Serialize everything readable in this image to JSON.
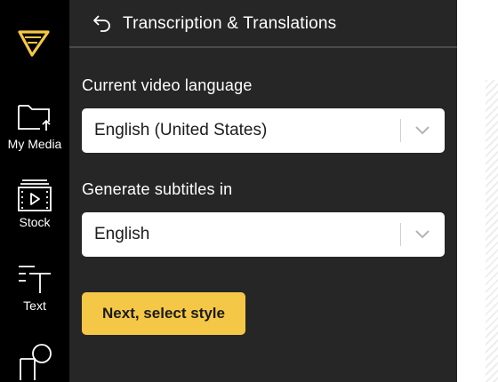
{
  "sidebar": {
    "items": [
      {
        "label": "My Media",
        "icon": "folder-upload-icon"
      },
      {
        "label": "Stock",
        "icon": "film-strip-icon"
      },
      {
        "label": "Text",
        "icon": "text-tool-icon"
      },
      {
        "label": "",
        "icon": "shapes-icon"
      }
    ]
  },
  "panel": {
    "title": "Transcription & Translations",
    "current_language": {
      "label": "Current video language",
      "value": "English (United States)"
    },
    "subtitle_language": {
      "label": "Generate subtitles in",
      "value": "English"
    },
    "next_button": "Next, select style"
  },
  "colors": {
    "rail_bg": "#000000",
    "panel_bg": "#262626",
    "accent": "#f5c746",
    "text": "#ffffff"
  }
}
